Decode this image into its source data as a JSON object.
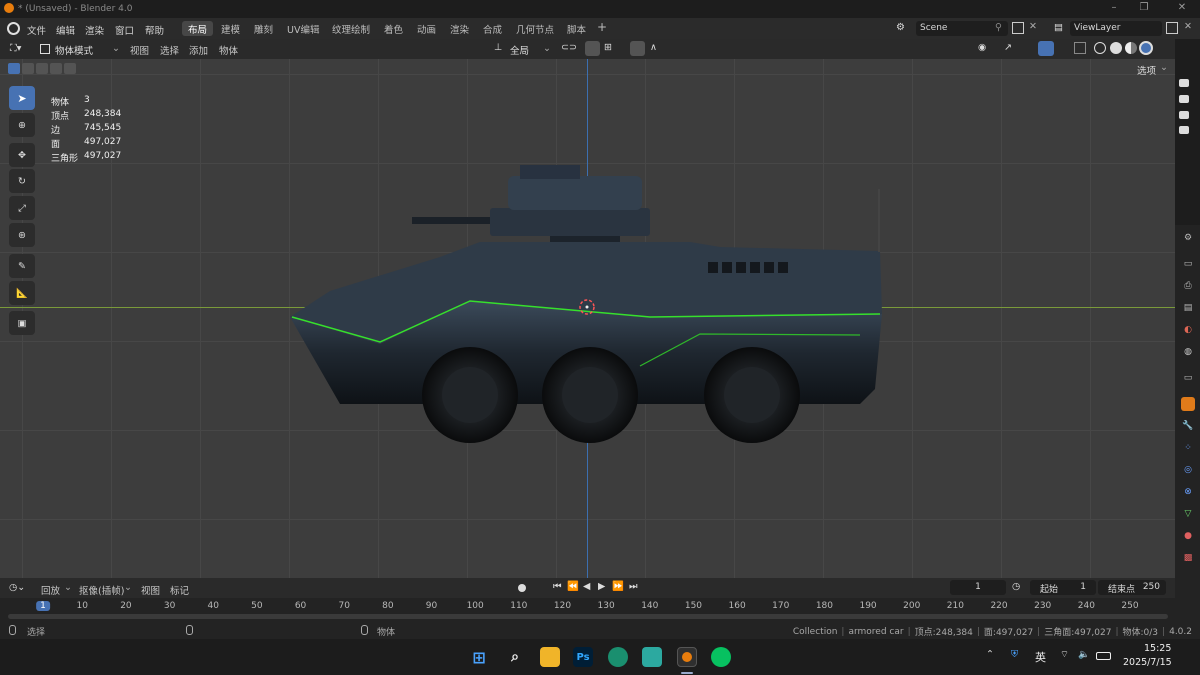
{
  "window": {
    "title": "* (Unsaved) - Blender 4.0"
  },
  "menu": {
    "file": "文件",
    "edit": "编辑",
    "render": "渲染",
    "window": "窗口",
    "help": "帮助"
  },
  "workspaces": [
    "布局",
    "建模",
    "雕刻",
    "UV编辑",
    "纹理绘制",
    "着色",
    "动画",
    "渲染",
    "合成",
    "几何节点",
    "脚本"
  ],
  "active_workspace": "布局",
  "scene": {
    "name": "Scene"
  },
  "view_layer": {
    "name": "ViewLayer"
  },
  "viewport_header": {
    "mode": "物体模式",
    "view": "视图",
    "select": "选择",
    "add": "添加",
    "object": "物体",
    "transform_orientation": "全局",
    "options": "选项"
  },
  "stats": {
    "objects": {
      "label": "物体",
      "value": "3"
    },
    "vertices": {
      "label": "顶点",
      "value": "248,384"
    },
    "edges": {
      "label": "边",
      "value": "745,545"
    },
    "faces": {
      "label": "面",
      "value": "497,027"
    },
    "triangles": {
      "label": "三角形",
      "value": "497,027"
    }
  },
  "timeline": {
    "playback": "回放",
    "keying": "抠像(插帧)",
    "view": "视图",
    "marker": "标记",
    "current_frame": "1",
    "start_label": "起始",
    "start": "1",
    "end_label": "结束点",
    "end": "250",
    "frames": [
      "1",
      "10",
      "20",
      "30",
      "40",
      "50",
      "60",
      "70",
      "80",
      "90",
      "100",
      "110",
      "120",
      "130",
      "140",
      "150",
      "160",
      "170",
      "180",
      "190",
      "200",
      "210",
      "220",
      "230",
      "240",
      "250"
    ]
  },
  "status": {
    "select": "选择",
    "object": "物体",
    "collection": "Collection",
    "active_object": "armored car",
    "vertices": "顶点:248,384",
    "faces": "面:497,027",
    "triangles": "三角面:497,027",
    "objects": "物体:0/3",
    "version": "4.0.2"
  },
  "taskbar": {
    "time": "15:25",
    "date": "2025/7/15",
    "ime": "英",
    "ps_label": "Ps"
  },
  "colors": {
    "accent": "#4772b3",
    "tank_body": "#2a3440",
    "trim_green": "#36e02c",
    "x_axis": "#7a9a3a",
    "y_axis": "#3c6fb0"
  }
}
